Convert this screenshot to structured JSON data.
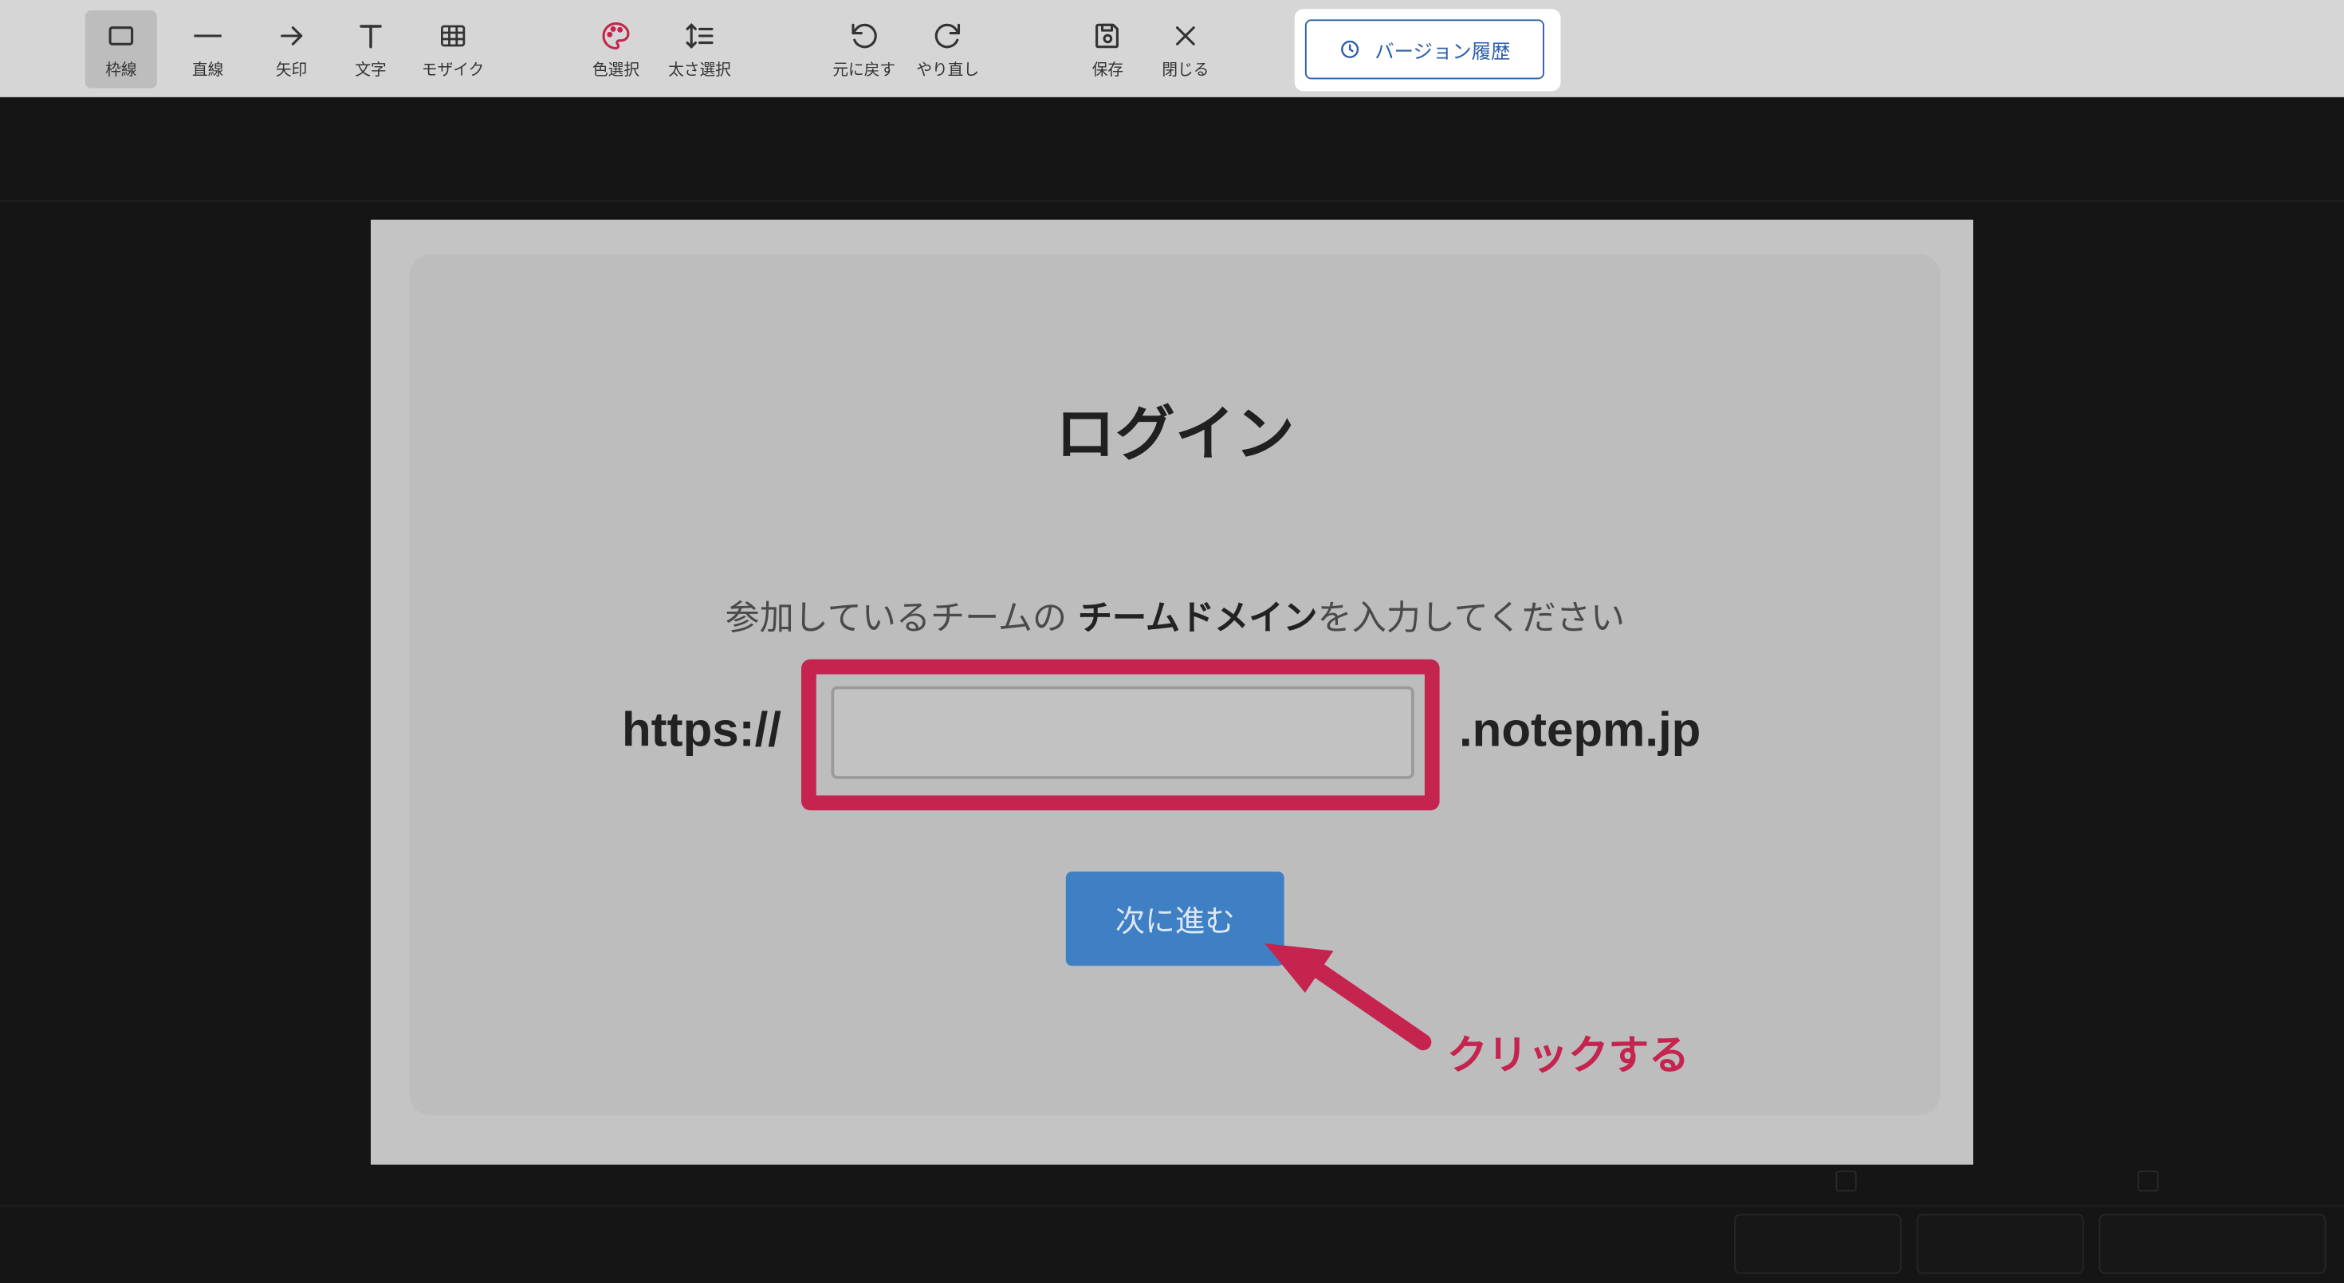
{
  "toolbar": {
    "tools": [
      {
        "id": "frame",
        "label": "枠線",
        "icon": "rectangle-icon",
        "active": true
      },
      {
        "id": "line",
        "label": "直線",
        "icon": "line-icon"
      },
      {
        "id": "arrow",
        "label": "矢印",
        "icon": "arrow-right-icon"
      },
      {
        "id": "text",
        "label": "文字",
        "icon": "text-icon"
      },
      {
        "id": "mosaic",
        "label": "モザイク",
        "icon": "grid-icon"
      },
      {
        "id": "color",
        "label": "色選択",
        "icon": "palette-icon",
        "accent": "#c5244f"
      },
      {
        "id": "thickness",
        "label": "太さ選択",
        "icon": "line-height-icon"
      },
      {
        "id": "undo",
        "label": "元に戻す",
        "icon": "undo-icon"
      },
      {
        "id": "redo",
        "label": "やり直し",
        "icon": "redo-icon"
      },
      {
        "id": "save",
        "label": "保存",
        "icon": "save-icon"
      },
      {
        "id": "close",
        "label": "閉じる",
        "icon": "close-icon"
      }
    ],
    "version_history": {
      "label": "バージョン履歴",
      "icon": "clock-icon",
      "color": "#2d5da8"
    }
  },
  "screenshot": {
    "title": "ログイン",
    "instruction_pre": "参加しているチームの ",
    "instruction_bold": "チームドメイン",
    "instruction_post": "を入力してください",
    "url_prefix": "https://",
    "url_suffix": ".notepm.jp",
    "domain_value": "",
    "next_button": "次に進む",
    "button_color": "#3f7fc4"
  },
  "annotations": {
    "color": "#c5244f",
    "callout_text": "クリックする"
  }
}
